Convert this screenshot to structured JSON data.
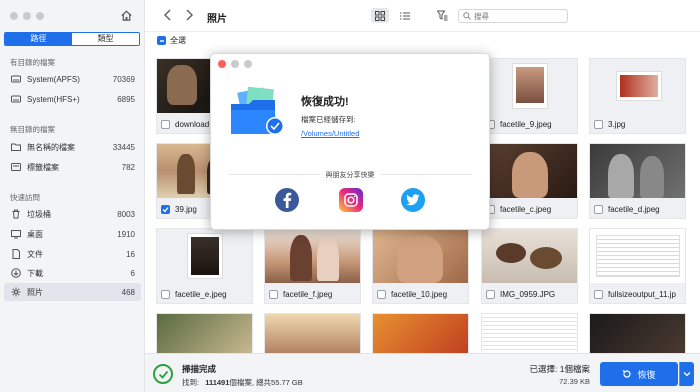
{
  "sidebar": {
    "tabs": {
      "path": "路徑",
      "type": "類型"
    },
    "sections": {
      "with_dir": "有目錄的檔案",
      "no_dir": "無目錄的檔案",
      "quick": "快速訪問"
    },
    "with_dir_items": [
      {
        "label": "System(APFS)",
        "count": "70369",
        "icon": "disk-icon"
      },
      {
        "label": "System(HFS+)",
        "count": "6895",
        "icon": "disk-icon"
      }
    ],
    "no_dir_items": [
      {
        "label": "無名稱的檔案",
        "count": "33445",
        "icon": "folder-icon"
      },
      {
        "label": "標籤檔案",
        "count": "782",
        "icon": "tag-icon"
      }
    ],
    "quick_items": [
      {
        "label": "垃圾桶",
        "count": "8003",
        "icon": "trash-icon"
      },
      {
        "label": "桌面",
        "count": "1910",
        "icon": "desktop-icon"
      },
      {
        "label": "文件",
        "count": "16",
        "icon": "document-icon"
      },
      {
        "label": "下載",
        "count": "6",
        "icon": "download-icon"
      },
      {
        "label": "照片",
        "count": "468",
        "icon": "photos-icon"
      }
    ]
  },
  "header": {
    "title": "照片",
    "search_placeholder": "搜尋",
    "select_all": "全選"
  },
  "files": [
    {
      "name": "download-y",
      "checked": false
    },
    {
      "name": "facetile_9.jpeg",
      "checked": false
    },
    {
      "name": "3.jpg",
      "checked": false
    },
    {
      "name": "39.jpg",
      "checked": true
    },
    {
      "name": "facetile_c.jpeg",
      "checked": false
    },
    {
      "name": "facetile_d.jpeg",
      "checked": false
    },
    {
      "name": "facetile_e.jpeg",
      "checked": false
    },
    {
      "name": "facetile_f.jpeg",
      "checked": false
    },
    {
      "name": "facetile_10.jpeg",
      "checked": false
    },
    {
      "name": "IMG_0959.JPG",
      "checked": false
    },
    {
      "name": "fullsizeoutput_11.jp",
      "checked": false
    }
  ],
  "dialog": {
    "title": "恢復成功!",
    "saved_to": "檔案已經儲存到:",
    "path": "/Volumes/Untitled",
    "share": "與朋友分享快樂"
  },
  "status": {
    "title": "掃描完成",
    "found_prefix": "找到:",
    "found_count": "111491",
    "found_unit": "個檔案",
    "total": "總共55.77 GB",
    "selected": "已選擇: 1個檔案",
    "size": "72.39 KB",
    "recover": "恢復"
  },
  "colors": {
    "accent": "#1f6feb",
    "success": "#2ea043",
    "facebook": "#3b5998",
    "twitter": "#1da1f2"
  }
}
